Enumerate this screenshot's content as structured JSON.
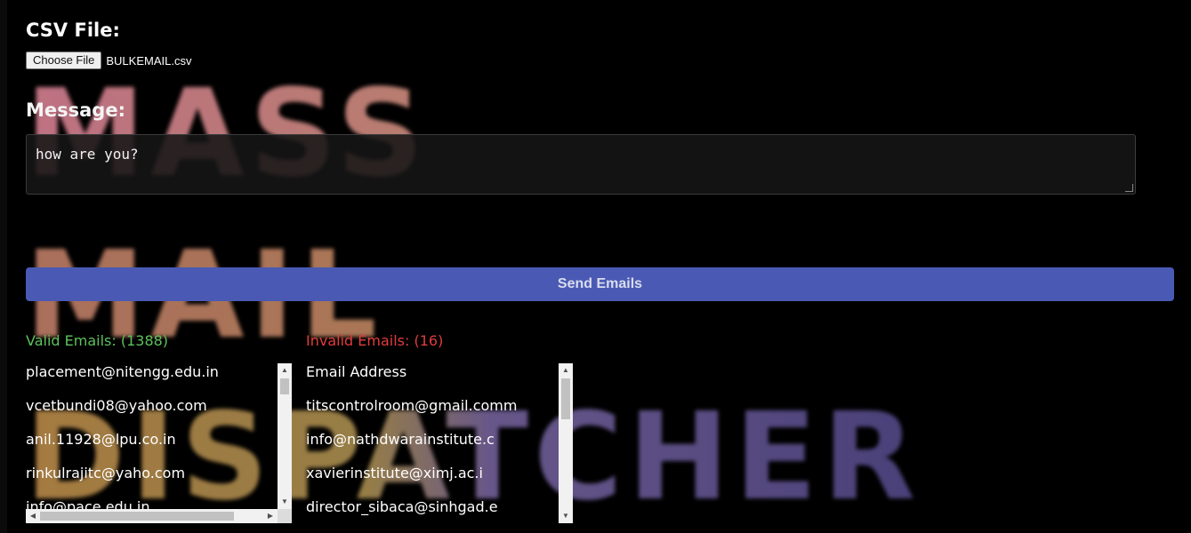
{
  "background_title": {
    "lines": [
      "MASS",
      "MAIL",
      "DISPATCHER"
    ]
  },
  "form": {
    "csv_label": "CSV File:",
    "choose_file_label": "Choose File",
    "file_name": "BULKEMAIL.csv",
    "message_label": "Message:",
    "message_value": "how are you?",
    "send_button_label": "Send Emails"
  },
  "valid": {
    "header": "Valid Emails: (1388)",
    "items": [
      "placement@nitengg.edu.in",
      "vcetbundi08@yahoo.com",
      "anil.11928@lpu.co.in",
      "rinkulrajitc@yaho.com",
      "info@pace.edu.in"
    ]
  },
  "invalid": {
    "header": "Invalid Emails: (16)",
    "items": [
      "Email Address",
      "titscontrolroom@gmail.comm",
      "info@nathdwarainstitute.c",
      "xavierinstitute@ximj.ac.i",
      "director_sibaca@sinhgad.e"
    ]
  },
  "colors": {
    "send_button": "#4a5ab4",
    "valid_header": "#5cc15c",
    "invalid_header": "#e23c3c",
    "background": "#000000"
  }
}
